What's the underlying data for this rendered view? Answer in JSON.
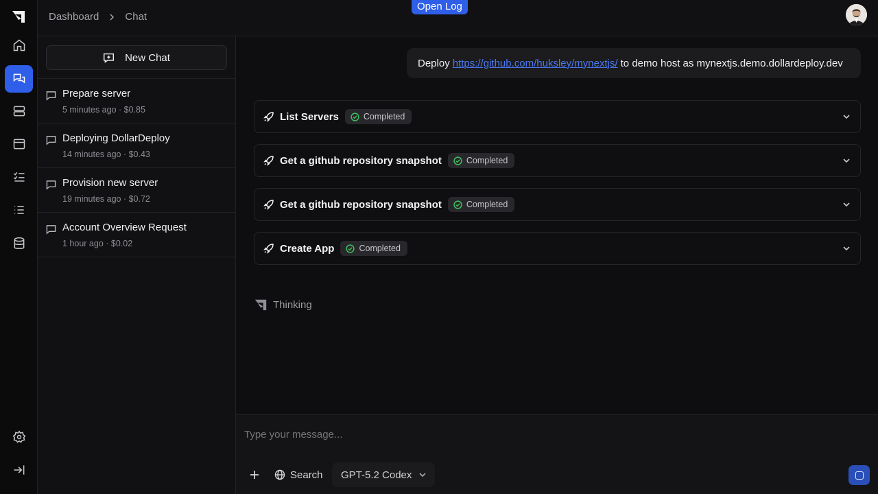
{
  "header": {
    "breadcrumbs": [
      "Dashboard",
      "Chat"
    ],
    "open_log_label": "Open Log"
  },
  "rail": {
    "items": [
      "logo-icon",
      "home-icon",
      "chat-icon",
      "servers-icon",
      "apps-icon",
      "tasks-icon",
      "list-icon",
      "database-icon",
      "settings-icon",
      "collapse-icon"
    ],
    "active": "chat-icon"
  },
  "sidebar": {
    "new_chat_label": "New Chat",
    "chats": [
      {
        "title": "Prepare server",
        "meta": "5 minutes ago · $0.85"
      },
      {
        "title": "Deploying DollarDeploy",
        "meta": "14 minutes ago · $0.43"
      },
      {
        "title": "Provision new server",
        "meta": "19 minutes ago · $0.72"
      },
      {
        "title": "Account Overview Request",
        "meta": "1 hour ago · $0.02"
      }
    ]
  },
  "conversation": {
    "user_message": {
      "prefix": "Deploy",
      "link": "https://github.com/huksley/mynextjs/",
      "suffix": "to demo host as mynextjs.demo.dollardeploy.dev"
    },
    "tools": [
      {
        "name": "List Servers",
        "status": "Completed"
      },
      {
        "name": "Get a github repository snapshot",
        "status": "Completed"
      },
      {
        "name": "Get a github repository snapshot",
        "status": "Completed"
      },
      {
        "name": "Create App",
        "status": "Completed"
      }
    ],
    "thinking_label": "Thinking"
  },
  "composer": {
    "placeholder": "Type your message...",
    "search_label": "Search",
    "model": "GPT-5.2 Codex"
  },
  "colors": {
    "accent": "#2f5fe8",
    "success": "#3fbf5f",
    "background": "#0e0e10"
  }
}
